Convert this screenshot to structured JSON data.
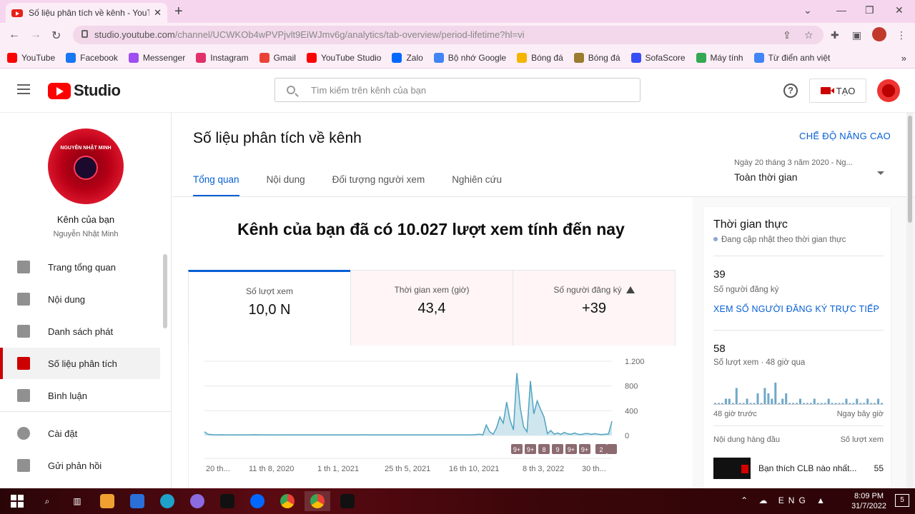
{
  "browser": {
    "tab_title": "Số liệu phân tích về kênh - YouTube Studio",
    "new_tab": "+",
    "url_host": "studio.youtube.com",
    "url_path": "/channel/UCWKOb4wPVPjvlt9EiWJmv6g/analytics/tab-overview/period-lifetime?hl=vi",
    "bookmarks": [
      {
        "label": "YouTube",
        "color": "#ff0000"
      },
      {
        "label": "Facebook",
        "color": "#1877f2"
      },
      {
        "label": "Messenger",
        "color": "#a04df0"
      },
      {
        "label": "Instagram",
        "color": "#e1306c"
      },
      {
        "label": "Gmail",
        "color": "#ea4335"
      },
      {
        "label": "YouTube Studio",
        "color": "#ff0000"
      },
      {
        "label": "Zalo",
        "color": "#0068ff"
      },
      {
        "label": "Bộ nhớ Google",
        "color": "#4285f4"
      },
      {
        "label": "Bóng đá",
        "color": "#f4b400"
      },
      {
        "label": "Bóng đá",
        "color": "#9a7b2f"
      },
      {
        "label": "SofaScore",
        "color": "#374df5"
      },
      {
        "label": "Máy tính",
        "color": "#34a853"
      },
      {
        "label": "Từ điển anh việt",
        "color": "#4285f4"
      }
    ],
    "more": "»"
  },
  "studio": {
    "logo_text": "Studio",
    "search_placeholder": "Tìm kiếm trên kênh của bạn",
    "help": "?",
    "create_label": "TẠO"
  },
  "sidebar": {
    "channel_label": "Kênh của bạn",
    "channel_name": "Nguyễn Nhật Minh",
    "avatar_text": "NGUYỄN NHẬT MINH",
    "items": [
      {
        "label": "Trang tổng quan",
        "icon": "dashboard-icon"
      },
      {
        "label": "Nội dung",
        "icon": "content-icon"
      },
      {
        "label": "Danh sách phát",
        "icon": "playlist-icon"
      },
      {
        "label": "Số liệu phân tích",
        "icon": "analytics-icon",
        "active": true
      },
      {
        "label": "Bình luận",
        "icon": "comments-icon"
      },
      {
        "label": "Cài đặt",
        "icon": "settings-icon"
      },
      {
        "label": "Gửi phản hồi",
        "icon": "feedback-icon"
      }
    ]
  },
  "main": {
    "title": "Số liệu phân tích về kênh",
    "advanced": "CHẾ ĐỘ NÂNG CAO",
    "tabs": [
      "Tổng quan",
      "Nội dung",
      "Đối tượng người xem",
      "Nghiên cứu"
    ],
    "date_range": "Ngày 20 tháng 3 năm 2020 - Ng...",
    "date_period": "Toàn thời gian",
    "headline": "Kênh của bạn đã có 10.027 lượt xem tính đến nay",
    "cards": [
      {
        "label": "Số lượt xem",
        "value": "10,0 N"
      },
      {
        "label": "Thời gian xem (giờ)",
        "value": "43,4"
      },
      {
        "label": "Số người đăng ký",
        "value": "+39"
      }
    ],
    "badges": [
      "9+",
      "9+",
      "8",
      "9",
      "9+",
      "9+",
      "2"
    ]
  },
  "chart_data": {
    "type": "line",
    "title": "",
    "ylabel": "",
    "y_ticks": [
      "1.200",
      "800",
      "400",
      "0"
    ],
    "ylim": [
      0,
      1200
    ],
    "x_ticks": [
      "20 th...",
      "11 th 8, 2020",
      "1 th 1, 2021",
      "25 th 5, 2021",
      "16 th 10, 2021",
      "8 th 3, 2022",
      "30 th..."
    ],
    "series": [
      {
        "values": [
          60,
          20,
          15,
          10,
          10,
          12,
          10,
          10,
          8,
          10,
          10,
          10,
          10,
          10,
          10,
          12,
          10,
          10,
          10,
          10,
          10,
          8,
          10,
          10,
          10,
          10,
          10,
          10,
          10,
          10,
          10,
          10,
          10,
          10,
          10,
          10,
          10,
          10,
          10,
          10,
          10,
          10,
          10,
          10,
          10,
          10,
          10,
          12,
          10,
          10,
          10,
          10,
          10,
          10,
          10,
          10,
          10,
          10,
          10,
          10,
          10,
          10,
          10,
          10,
          10,
          10,
          10,
          10,
          10,
          10,
          10,
          10,
          10,
          10,
          10,
          10,
          10,
          10,
          10,
          10,
          15,
          20,
          10,
          170,
          60,
          20,
          120,
          300,
          200,
          540,
          250,
          90,
          1010,
          450,
          140,
          60,
          880,
          350,
          560,
          420,
          300,
          30,
          80,
          20,
          40,
          20,
          50,
          25,
          20,
          40,
          20,
          15,
          30,
          30,
          20,
          30,
          20,
          15,
          20,
          25,
          230
        ]
      }
    ]
  },
  "realtime": {
    "title": "Thời gian thực",
    "subtitle": "Đang cập nhật theo thời gian thực",
    "subs_value": "39",
    "subs_label": "Số người đăng ký",
    "subs_link": "XEM SỐ NGƯỜI ĐĂNG KÝ TRỰC TIẾP",
    "views_value": "58",
    "views_label": "Số lượt xem · 48 giờ qua",
    "bars": [
      0,
      0,
      0,
      1,
      1,
      0,
      3,
      0,
      0,
      1,
      0,
      0,
      2,
      0,
      3,
      2,
      1,
      4,
      0,
      1,
      2,
      0,
      0,
      0,
      1,
      0,
      0,
      0,
      1,
      0,
      0,
      0,
      1,
      0,
      0,
      0,
      0,
      1,
      0,
      0,
      1,
      0,
      0,
      1,
      0,
      0,
      1,
      0
    ],
    "axis_left": "48 giờ trước",
    "axis_right": "Ngay bây giờ",
    "top_content_label": "Nội dung hàng đầu",
    "top_views_label": "Số lượt xem",
    "top_video_title": "Bạn thích CLB nào nhất...",
    "top_video_views": "55"
  },
  "taskbar": {
    "time": "8:09 PM",
    "date": "31/7/2022",
    "tray": "ENG",
    "notifications": "5"
  }
}
